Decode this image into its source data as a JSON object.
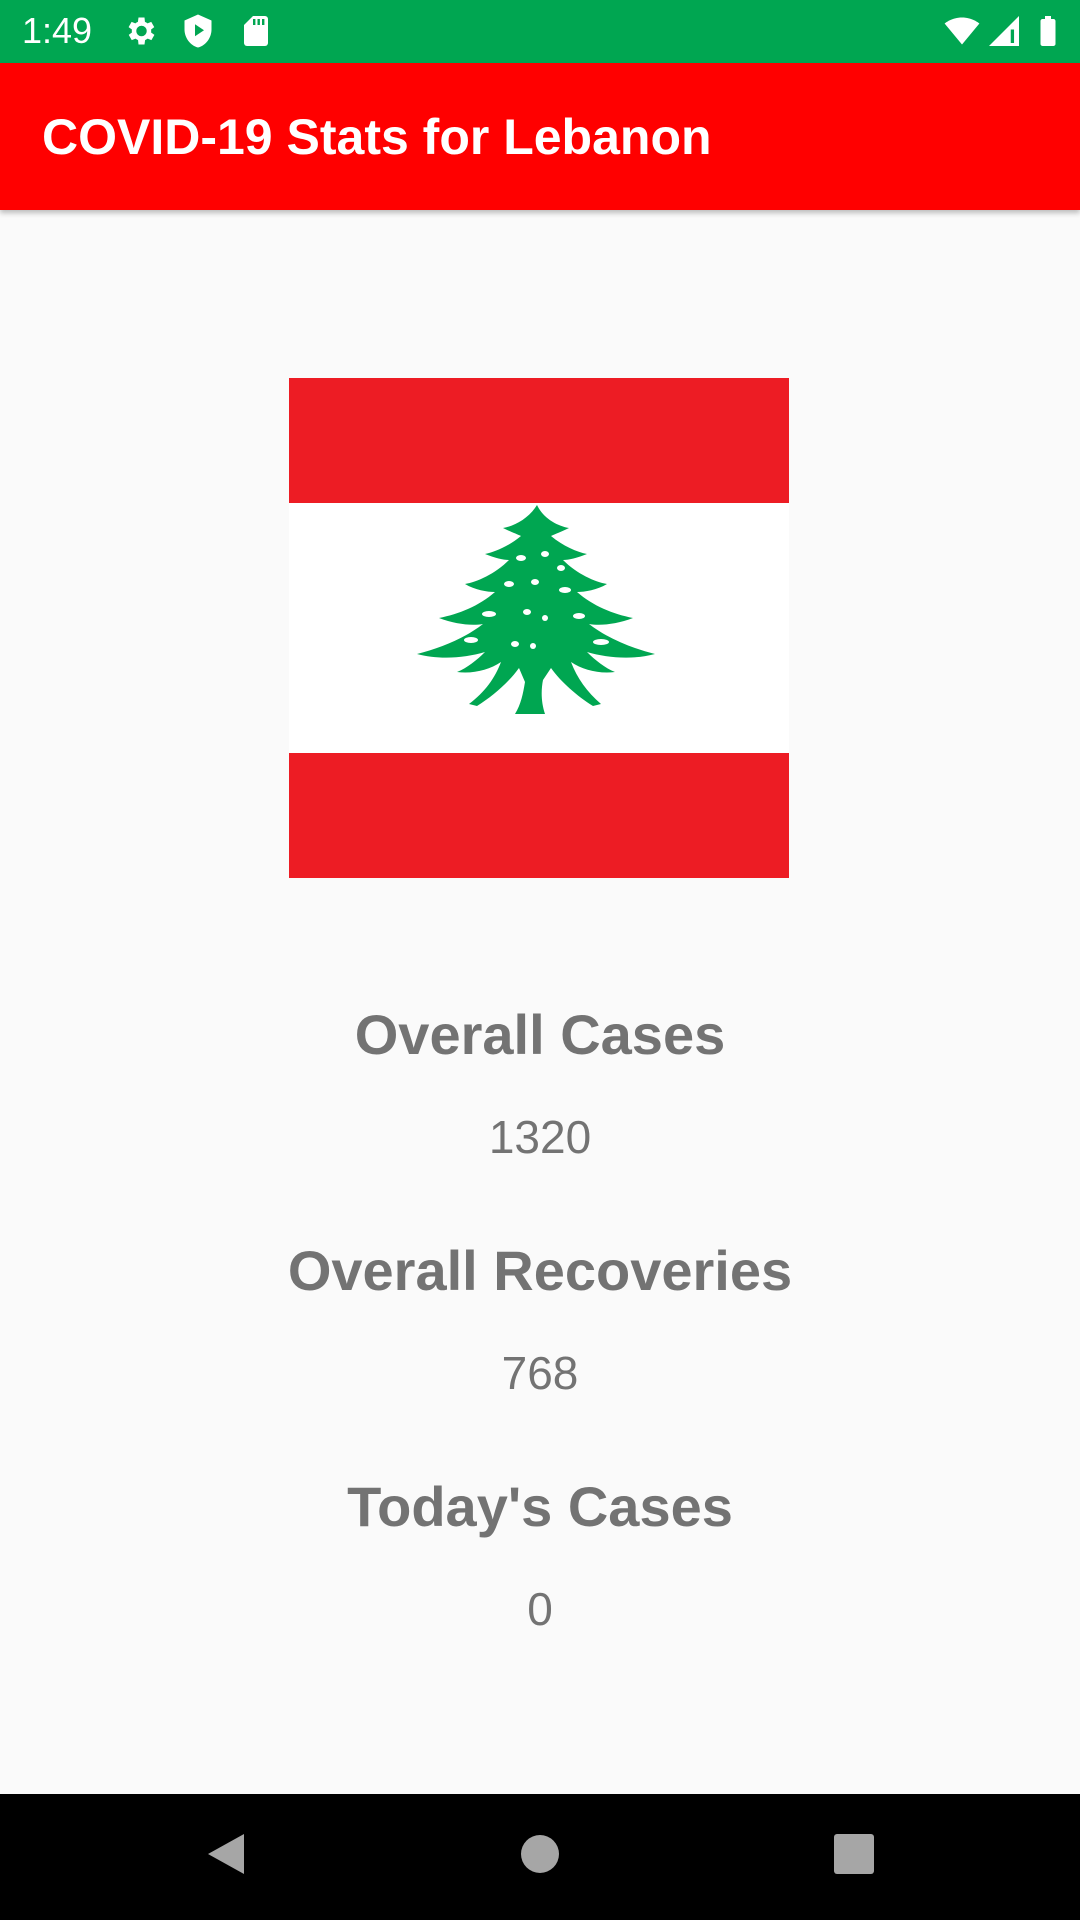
{
  "status_bar": {
    "time": "1:49",
    "icons": [
      "settings-icon",
      "shield-play-icon",
      "sd-card-icon",
      "wifi-icon",
      "cell-signal-icon",
      "battery-icon"
    ],
    "color": "#00a651"
  },
  "app_bar": {
    "title": "COVID-19 Stats for Lebanon",
    "color": "#ff0000"
  },
  "flag": {
    "icon": "lebanon-flag-image",
    "red": "#ed1c24",
    "green": "#00a651"
  },
  "stats": [
    {
      "label": "Overall Cases",
      "value": "1320"
    },
    {
      "label": "Overall Recoveries",
      "value": "768"
    },
    {
      "label": "Today's Cases",
      "value": "0"
    }
  ],
  "nav_bar": {
    "buttons": [
      "back-icon",
      "home-icon",
      "recents-icon"
    ]
  }
}
